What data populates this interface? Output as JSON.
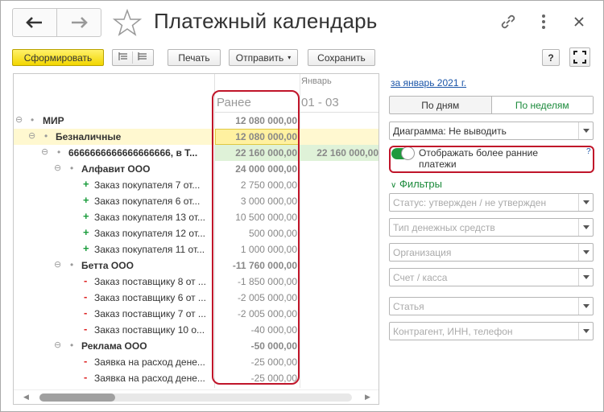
{
  "window": {
    "title": "Платежный календарь"
  },
  "toolbar": {
    "generate_label": "Сформировать",
    "print_label": "Печать",
    "send_label": "Отправить",
    "save_label": "Сохранить",
    "help_label": "?"
  },
  "grid": {
    "month_header": "Январь",
    "early_header": "Ранее",
    "period_header": "01 - 03",
    "rows": [
      {
        "name": "МИР",
        "early": "12 080 000,00",
        "month": ""
      },
      {
        "name": "Безналичные",
        "early": "12 080 000,00",
        "month": ""
      },
      {
        "name": "6666666666666666666, в Т...",
        "early": "22 160 000,00",
        "month": "22 160 000,00"
      },
      {
        "name": "Алфавит ООО",
        "early": "24 000 000,00",
        "month": ""
      },
      {
        "name": "Заказ покупателя 7 от...",
        "early": "2 750 000,00",
        "month": ""
      },
      {
        "name": "Заказ покупателя 6 от...",
        "early": "3 000 000,00",
        "month": ""
      },
      {
        "name": "Заказ покупателя 13 от...",
        "early": "10 500 000,00",
        "month": ""
      },
      {
        "name": "Заказ покупателя 12 от...",
        "early": "500 000,00",
        "month": ""
      },
      {
        "name": "Заказ покупателя 11 от...",
        "early": "1 000 000,00",
        "month": ""
      },
      {
        "name": "Бетта ООО",
        "early": "-11 760 000,00",
        "month": ""
      },
      {
        "name": "Заказ поставщику 8  от ...",
        "early": "-1 850 000,00",
        "month": ""
      },
      {
        "name": "Заказ поставщику 6  от ...",
        "early": "-2 005 000,00",
        "month": ""
      },
      {
        "name": "Заказ поставщику 7  от ...",
        "early": "-2 005 000,00",
        "month": ""
      },
      {
        "name": "Заказ поставщику 10  о...",
        "early": "-40 000,00",
        "month": ""
      },
      {
        "name": "Реклама ООО",
        "early": "-50 000,00",
        "month": ""
      },
      {
        "name": "Заявка на расход дене...",
        "early": "-25 000,00",
        "month": ""
      },
      {
        "name": "Заявка на расход дене...",
        "early": "-25 000,00",
        "month": ""
      }
    ]
  },
  "panel": {
    "period_link": "за январь 2021 г.",
    "by_days": "По дням",
    "by_weeks": "По неделям",
    "diagram_select": "Диаграмма: Не выводить",
    "show_earlier_label": "Отображать более ранние платежи",
    "help_mark": "?",
    "filters_header": "Фильтры",
    "filters": [
      "Статус: утвержден / не утвержден",
      "Тип денежных средств",
      "Организация",
      "Счет / касса",
      "Статья",
      "Контрагент, ИНН, телефон"
    ]
  },
  "colors": {
    "accent_green": "#1a8a3a",
    "highlight_red": "#c0152a",
    "primary_yellow": "#f2d600"
  }
}
